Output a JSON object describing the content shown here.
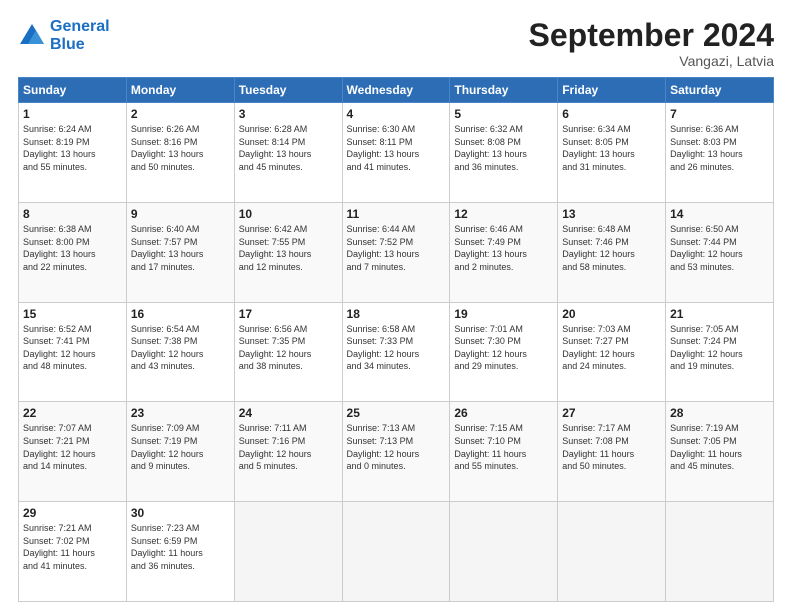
{
  "logo": {
    "line1": "General",
    "line2": "Blue"
  },
  "header": {
    "month": "September 2024",
    "location": "Vangazi, Latvia"
  },
  "days_of_week": [
    "Sunday",
    "Monday",
    "Tuesday",
    "Wednesday",
    "Thursday",
    "Friday",
    "Saturday"
  ],
  "weeks": [
    [
      {
        "day": "1",
        "info": "Sunrise: 6:24 AM\nSunset: 8:19 PM\nDaylight: 13 hours\nand 55 minutes."
      },
      {
        "day": "2",
        "info": "Sunrise: 6:26 AM\nSunset: 8:16 PM\nDaylight: 13 hours\nand 50 minutes."
      },
      {
        "day": "3",
        "info": "Sunrise: 6:28 AM\nSunset: 8:14 PM\nDaylight: 13 hours\nand 45 minutes."
      },
      {
        "day": "4",
        "info": "Sunrise: 6:30 AM\nSunset: 8:11 PM\nDaylight: 13 hours\nand 41 minutes."
      },
      {
        "day": "5",
        "info": "Sunrise: 6:32 AM\nSunset: 8:08 PM\nDaylight: 13 hours\nand 36 minutes."
      },
      {
        "day": "6",
        "info": "Sunrise: 6:34 AM\nSunset: 8:05 PM\nDaylight: 13 hours\nand 31 minutes."
      },
      {
        "day": "7",
        "info": "Sunrise: 6:36 AM\nSunset: 8:03 PM\nDaylight: 13 hours\nand 26 minutes."
      }
    ],
    [
      {
        "day": "8",
        "info": "Sunrise: 6:38 AM\nSunset: 8:00 PM\nDaylight: 13 hours\nand 22 minutes."
      },
      {
        "day": "9",
        "info": "Sunrise: 6:40 AM\nSunset: 7:57 PM\nDaylight: 13 hours\nand 17 minutes."
      },
      {
        "day": "10",
        "info": "Sunrise: 6:42 AM\nSunset: 7:55 PM\nDaylight: 13 hours\nand 12 minutes."
      },
      {
        "day": "11",
        "info": "Sunrise: 6:44 AM\nSunset: 7:52 PM\nDaylight: 13 hours\nand 7 minutes."
      },
      {
        "day": "12",
        "info": "Sunrise: 6:46 AM\nSunset: 7:49 PM\nDaylight: 13 hours\nand 2 minutes."
      },
      {
        "day": "13",
        "info": "Sunrise: 6:48 AM\nSunset: 7:46 PM\nDaylight: 12 hours\nand 58 minutes."
      },
      {
        "day": "14",
        "info": "Sunrise: 6:50 AM\nSunset: 7:44 PM\nDaylight: 12 hours\nand 53 minutes."
      }
    ],
    [
      {
        "day": "15",
        "info": "Sunrise: 6:52 AM\nSunset: 7:41 PM\nDaylight: 12 hours\nand 48 minutes."
      },
      {
        "day": "16",
        "info": "Sunrise: 6:54 AM\nSunset: 7:38 PM\nDaylight: 12 hours\nand 43 minutes."
      },
      {
        "day": "17",
        "info": "Sunrise: 6:56 AM\nSunset: 7:35 PM\nDaylight: 12 hours\nand 38 minutes."
      },
      {
        "day": "18",
        "info": "Sunrise: 6:58 AM\nSunset: 7:33 PM\nDaylight: 12 hours\nand 34 minutes."
      },
      {
        "day": "19",
        "info": "Sunrise: 7:01 AM\nSunset: 7:30 PM\nDaylight: 12 hours\nand 29 minutes."
      },
      {
        "day": "20",
        "info": "Sunrise: 7:03 AM\nSunset: 7:27 PM\nDaylight: 12 hours\nand 24 minutes."
      },
      {
        "day": "21",
        "info": "Sunrise: 7:05 AM\nSunset: 7:24 PM\nDaylight: 12 hours\nand 19 minutes."
      }
    ],
    [
      {
        "day": "22",
        "info": "Sunrise: 7:07 AM\nSunset: 7:21 PM\nDaylight: 12 hours\nand 14 minutes."
      },
      {
        "day": "23",
        "info": "Sunrise: 7:09 AM\nSunset: 7:19 PM\nDaylight: 12 hours\nand 9 minutes."
      },
      {
        "day": "24",
        "info": "Sunrise: 7:11 AM\nSunset: 7:16 PM\nDaylight: 12 hours\nand 5 minutes."
      },
      {
        "day": "25",
        "info": "Sunrise: 7:13 AM\nSunset: 7:13 PM\nDaylight: 12 hours\nand 0 minutes."
      },
      {
        "day": "26",
        "info": "Sunrise: 7:15 AM\nSunset: 7:10 PM\nDaylight: 11 hours\nand 55 minutes."
      },
      {
        "day": "27",
        "info": "Sunrise: 7:17 AM\nSunset: 7:08 PM\nDaylight: 11 hours\nand 50 minutes."
      },
      {
        "day": "28",
        "info": "Sunrise: 7:19 AM\nSunset: 7:05 PM\nDaylight: 11 hours\nand 45 minutes."
      }
    ],
    [
      {
        "day": "29",
        "info": "Sunrise: 7:21 AM\nSunset: 7:02 PM\nDaylight: 11 hours\nand 41 minutes."
      },
      {
        "day": "30",
        "info": "Sunrise: 7:23 AM\nSunset: 6:59 PM\nDaylight: 11 hours\nand 36 minutes."
      },
      {
        "day": "",
        "info": ""
      },
      {
        "day": "",
        "info": ""
      },
      {
        "day": "",
        "info": ""
      },
      {
        "day": "",
        "info": ""
      },
      {
        "day": "",
        "info": ""
      }
    ]
  ]
}
